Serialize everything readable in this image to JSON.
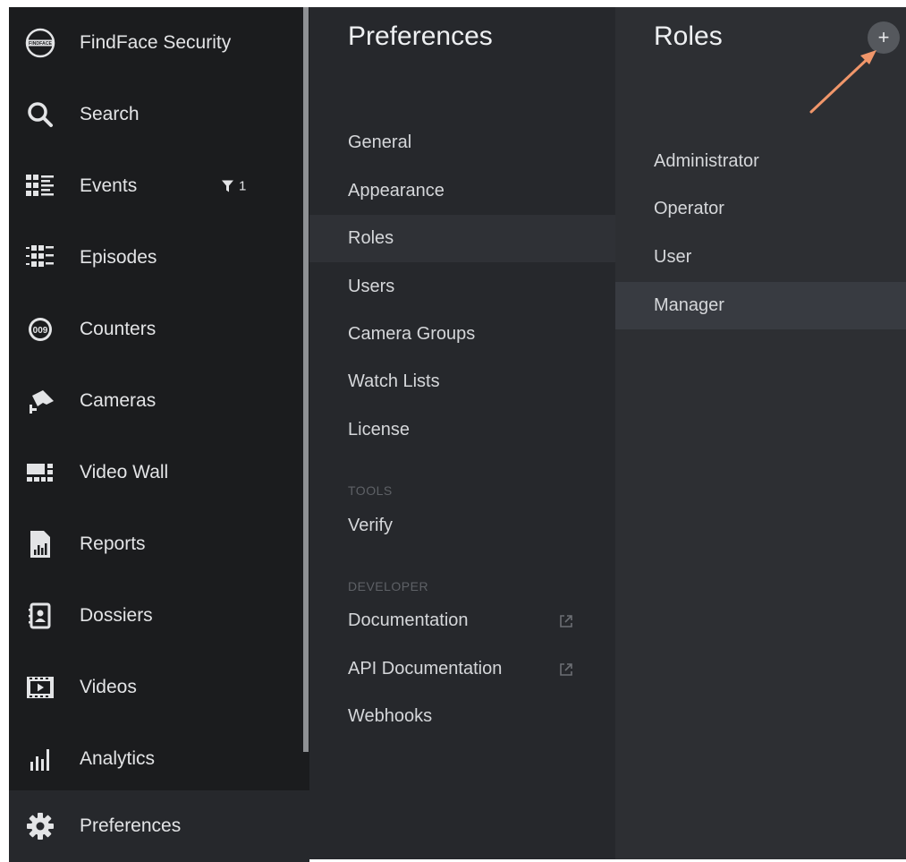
{
  "app": {
    "brand_name": "FindFace Security",
    "logo_text": "FINDFACE"
  },
  "nav": {
    "items": [
      {
        "label": "Search",
        "icon": "search-icon"
      },
      {
        "label": "Events",
        "icon": "events-icon"
      },
      {
        "label": "Episodes",
        "icon": "episodes-icon"
      },
      {
        "label": "Counters",
        "icon": "counters-icon"
      },
      {
        "label": "Cameras",
        "icon": "camera-icon"
      },
      {
        "label": "Video Wall",
        "icon": "video-wall-icon"
      },
      {
        "label": "Reports",
        "icon": "reports-icon"
      },
      {
        "label": "Dossiers",
        "icon": "dossiers-icon"
      },
      {
        "label": "Videos",
        "icon": "videos-icon"
      },
      {
        "label": "Analytics",
        "icon": "analytics-icon"
      }
    ],
    "events_filter_count": "1",
    "preferences_label": "Preferences"
  },
  "preferences": {
    "title": "Preferences",
    "items": [
      "General",
      "Appearance",
      "Roles",
      "Users",
      "Camera Groups",
      "Watch Lists",
      "License"
    ],
    "active": "Roles",
    "tools_header": "TOOLS",
    "tools_items": [
      "Verify"
    ],
    "developer_header": "DEVELOPER",
    "developer_items": [
      "Documentation",
      "API Documentation",
      "Webhooks"
    ]
  },
  "roles": {
    "title": "Roles",
    "add_label": "+",
    "items": [
      "Administrator",
      "Operator",
      "User",
      "Manager"
    ],
    "active": "Manager"
  },
  "colors": {
    "nav_bg": "#1b1c1e",
    "panel_bg": "#26282c",
    "roles_bg": "#2d2f33",
    "annotation_arrow": "#f0966a"
  }
}
